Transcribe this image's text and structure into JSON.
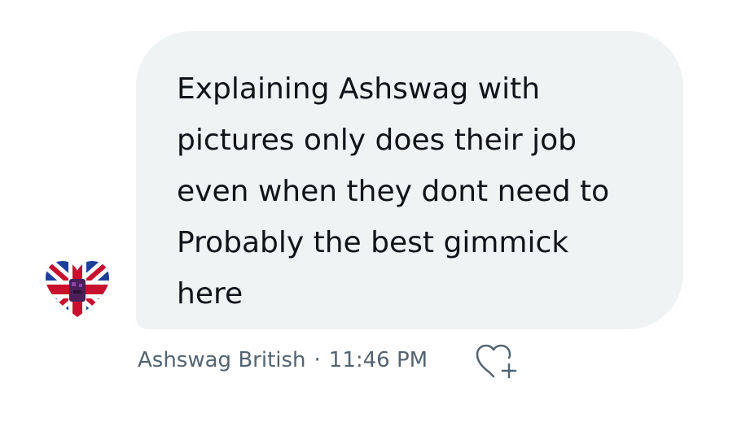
{
  "message": {
    "text": "Explaining Ashswag with\npictures only does their job\neven when they dont need to\nProbably the best gimmick\nhere"
  },
  "meta": {
    "sender": "Ashswag British",
    "separator": "·",
    "time": "11:46 PM"
  },
  "icons": {
    "avatar": "union-jack-heart-avatar",
    "react": "heart-plus-icon"
  },
  "colors": {
    "bubble_background": "#eff3f4",
    "message_text": "#0f1419",
    "meta_text": "#536471"
  }
}
